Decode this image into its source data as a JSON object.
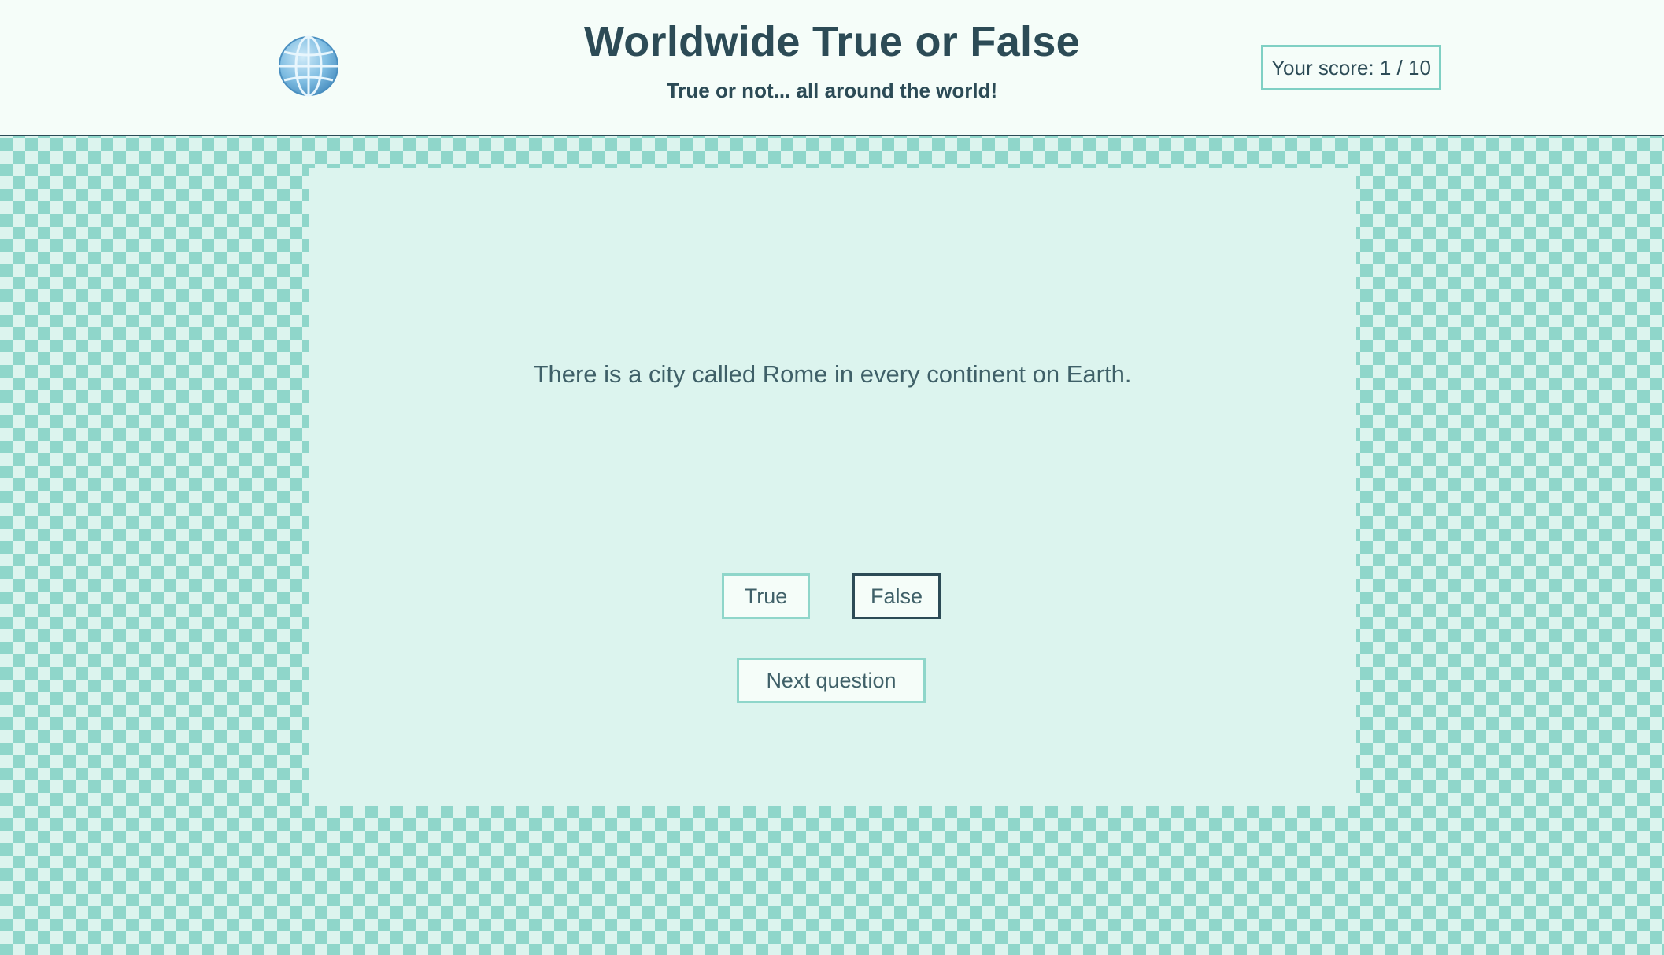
{
  "header": {
    "title": "Worldwide True or False",
    "subtitle": "True or not... all around the world!",
    "logo_icon": "globe-icon",
    "score_label": "Your score: 1 / 10"
  },
  "quiz": {
    "question": "There is a city called Rome in every continent on Earth.",
    "true_label": "True",
    "false_label": "False",
    "next_label": "Next question"
  },
  "colors": {
    "dark": "#2c4b56",
    "accent": "#8fd6ca",
    "card_bg": "#dcf4ee",
    "header_bg": "#f5fdf9"
  }
}
